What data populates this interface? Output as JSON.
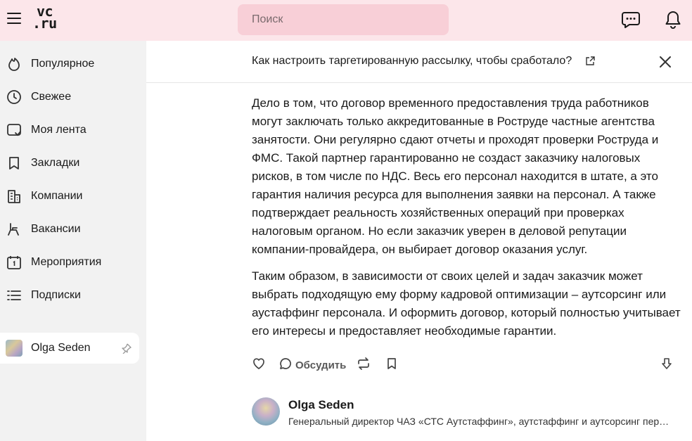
{
  "header": {
    "logo_line1": "vc",
    "logo_line2": ".ru",
    "search_placeholder": "Поиск"
  },
  "sidebar": {
    "items": [
      {
        "label": "Популярное",
        "icon": "flame-icon"
      },
      {
        "label": "Свежее",
        "icon": "clock-icon"
      },
      {
        "label": "Моя лента",
        "icon": "feed-icon"
      },
      {
        "label": "Закладки",
        "icon": "bookmark-icon"
      },
      {
        "label": "Компании",
        "icon": "building-icon"
      },
      {
        "label": "Вакансии",
        "icon": "chair-icon"
      },
      {
        "label": "Мероприятия",
        "icon": "calendar-icon"
      },
      {
        "label": "Подписки",
        "icon": "list-icon"
      }
    ],
    "subscription": {
      "label": "Olga Seden"
    }
  },
  "topbar": {
    "title": "Как настроить таргетированную рассылку, чтобы сработало?"
  },
  "article": {
    "paragraphs": [
      "Дело в том, что договор временного предоставления труда работников могут заключать только аккредитованные в Роструде частные агентства занятости. Они регулярно сдают отчеты и проходят проверки Роструда и ФМС. Такой партнер гарантированно не создаст заказчику налоговых рисков, в том числе по НДС. Весь его персонал находится в штате, а это гарантия наличия ресурса для выполнения заявки на персонал. А также подтверждает реальность хозяйственных операций при проверках налоговым органом. Но если заказчик уверен в деловой репутации компании-провайдера, он выбирает договор оказания услуг.",
      "Таким образом, в зависимости от своих целей и задач заказчик может выбрать подходящую ему форму кадровой оптимизации – аутсорсинг или аустаффинг персонала. И оформить договор, который полностью учитывает его интересы и предоставляет необходимые гарантии."
    ]
  },
  "actions": {
    "discuss_label": "Обсудить"
  },
  "author": {
    "name": "Olga Seden",
    "description": "Генеральный директор ЧАЗ «СТС Аутстаффинг», аутстаффинг и аутсорсинг персонала"
  }
}
